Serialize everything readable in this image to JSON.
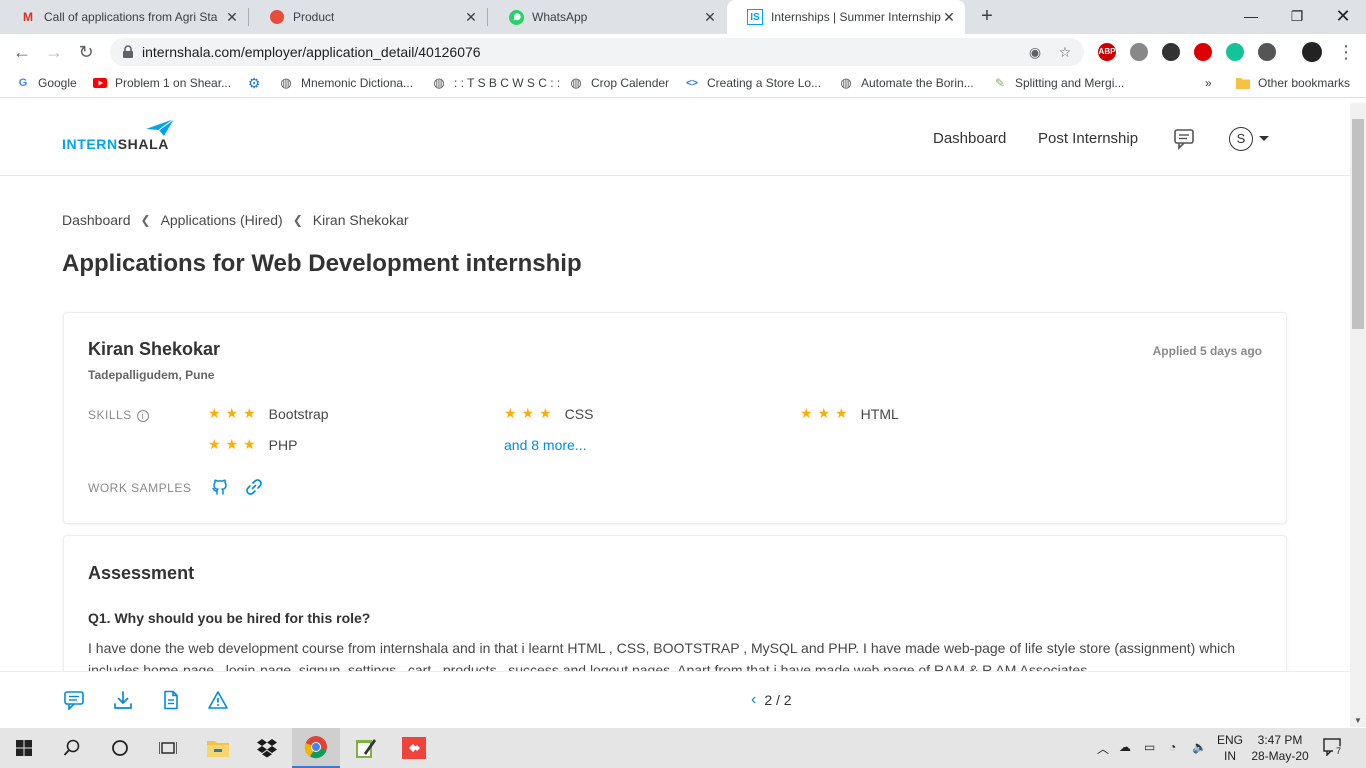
{
  "browser": {
    "tabs": [
      {
        "label": "Call of applications from Agri Sta",
        "icon": "gmail-icon",
        "color": "#d93025"
      },
      {
        "label": "Product",
        "icon": "record-dot-icon",
        "color": "#e74c3c"
      },
      {
        "label": "WhatsApp",
        "icon": "whatsapp-icon",
        "color": "#25d366"
      },
      {
        "label": "Internships | Summer Internship",
        "icon": "internshala-icon",
        "color": "#00a5ec"
      }
    ],
    "url": "internshala.com/employer/application_detail/40126076",
    "bookmarks": [
      "Google",
      "Problem 1 on Shear...",
      "Mnemonic Dictiona...",
      ": : T S B C W S C : :",
      "Crop Calender",
      "Creating a Store Lo...",
      "Automate the Borin...",
      "Splitting and Mergi...",
      "Other bookmarks"
    ],
    "more_bookmarks": "»",
    "ext_abp": "ABP"
  },
  "site": {
    "logo": {
      "part1": "INTERN",
      "part2": "SHALA"
    },
    "nav": {
      "dashboard": "Dashboard",
      "post": "Post Internship"
    },
    "avatar_letter": "S"
  },
  "breadcrumb": [
    "Dashboard",
    "Applications (Hired)",
    "Kiran Shekokar"
  ],
  "page_title": "Applications for Web Development internship",
  "applicant": {
    "name": "Kiran Shekokar",
    "location": "Tadepalligudem, Pune",
    "applied": "Applied 5 days ago",
    "skills_label": "SKILLS",
    "skills": [
      {
        "name": "Bootstrap",
        "rating": 3
      },
      {
        "name": "CSS",
        "rating": 3
      },
      {
        "name": "HTML",
        "rating": 3
      },
      {
        "name": "PHP",
        "rating": 3
      }
    ],
    "more_skills": "and 8 more...",
    "work_samples_label": "WORK SAMPLES"
  },
  "assessment": {
    "heading": "Assessment",
    "question": "Q1. Why should you be hired for this role?",
    "answer": "I have done the web development course from internshala and in that i learnt HTML , CSS, BOOTSTRAP , MySQL and PHP. I have made web-page of life style store (assignment) which includes home-page , login-page, signup, settings , cart , products , success and logout pages. Apart from that i have made web page of RAM & R AM Associates"
  },
  "pager": {
    "text": "2 / 2"
  },
  "taskbar": {
    "lang1": "ENG",
    "lang2": "IN",
    "time": "3:47 PM",
    "date": "28-May-20",
    "notif_count": "7"
  }
}
